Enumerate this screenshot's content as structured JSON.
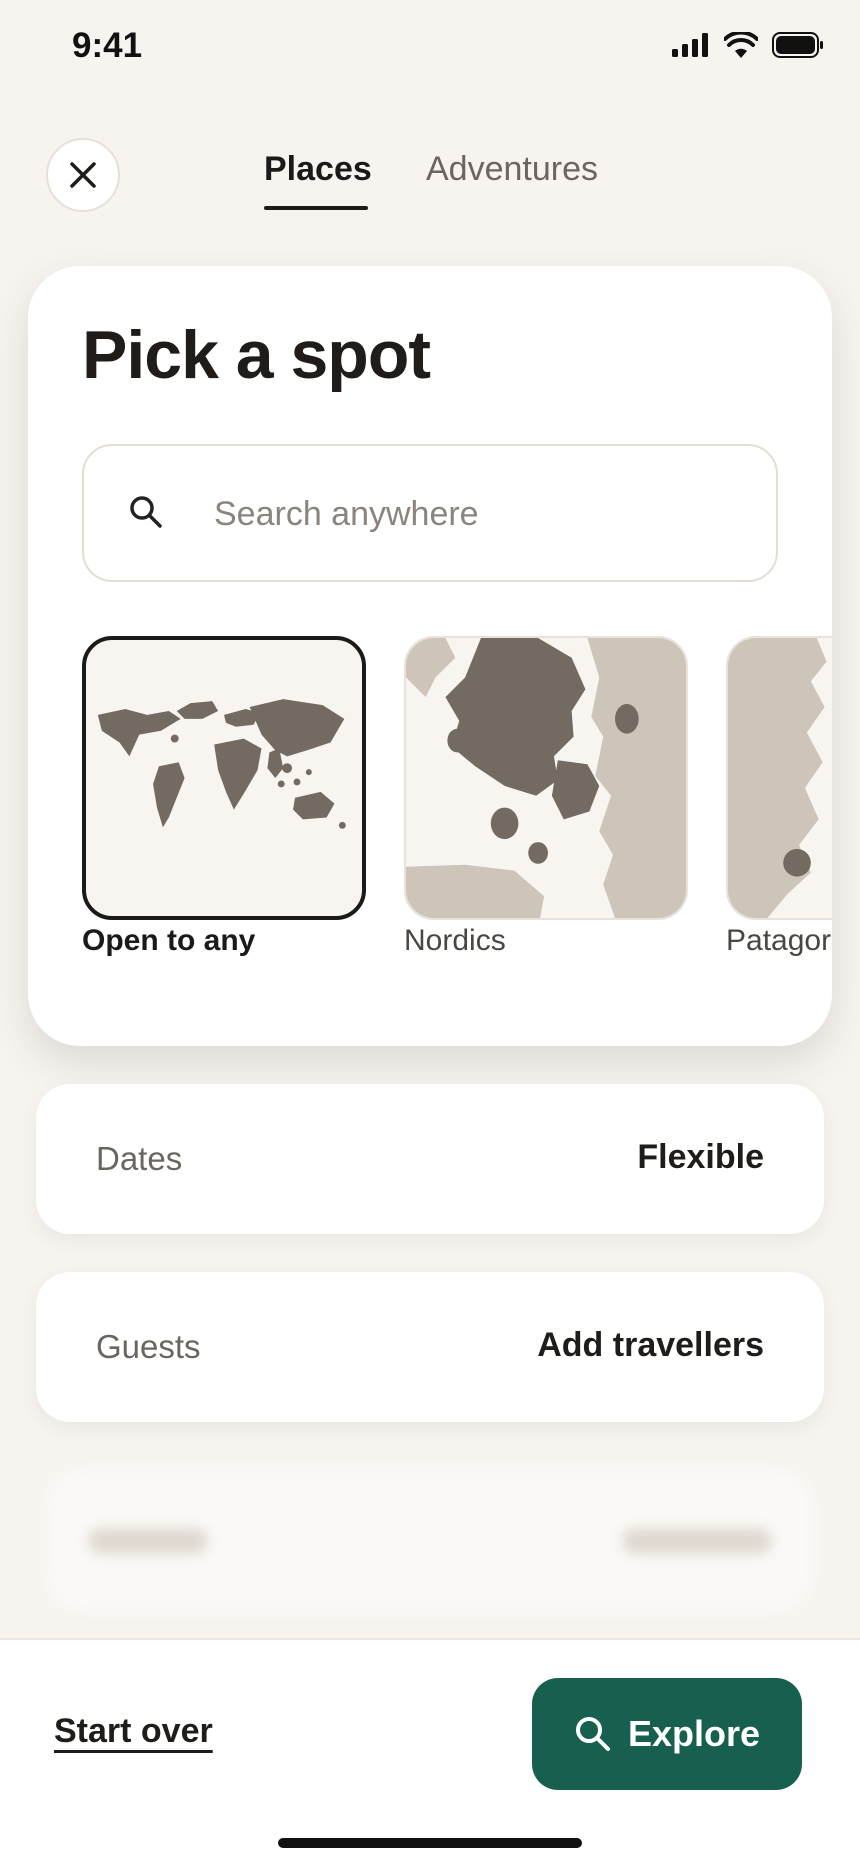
{
  "status_bar": {
    "time": "9:41",
    "icons": [
      "signal-icon",
      "wifi-icon",
      "battery-icon"
    ]
  },
  "header": {
    "close_icon": "close-icon",
    "tabs": [
      {
        "label": "Places",
        "active": true
      },
      {
        "label": "Adventures",
        "active": false
      }
    ]
  },
  "picker": {
    "title": "Pick a spot",
    "search": {
      "placeholder": "Search anywhere",
      "value": "",
      "icon": "search-icon"
    },
    "regions": [
      {
        "label": "Open to any",
        "selected": true
      },
      {
        "label": "Nordics",
        "selected": false
      },
      {
        "label": "Patagor",
        "selected": false
      }
    ]
  },
  "dates": {
    "label": "Dates",
    "value": "Flexible"
  },
  "guests": {
    "label": "Guests",
    "value": "Add travellers"
  },
  "footer": {
    "start_over": "Start over",
    "explore": "Explore"
  },
  "colors": {
    "accent": "#17604f",
    "background": "#f7f4f0",
    "map_dark": "#736a61",
    "map_light": "#cdc4ba"
  }
}
